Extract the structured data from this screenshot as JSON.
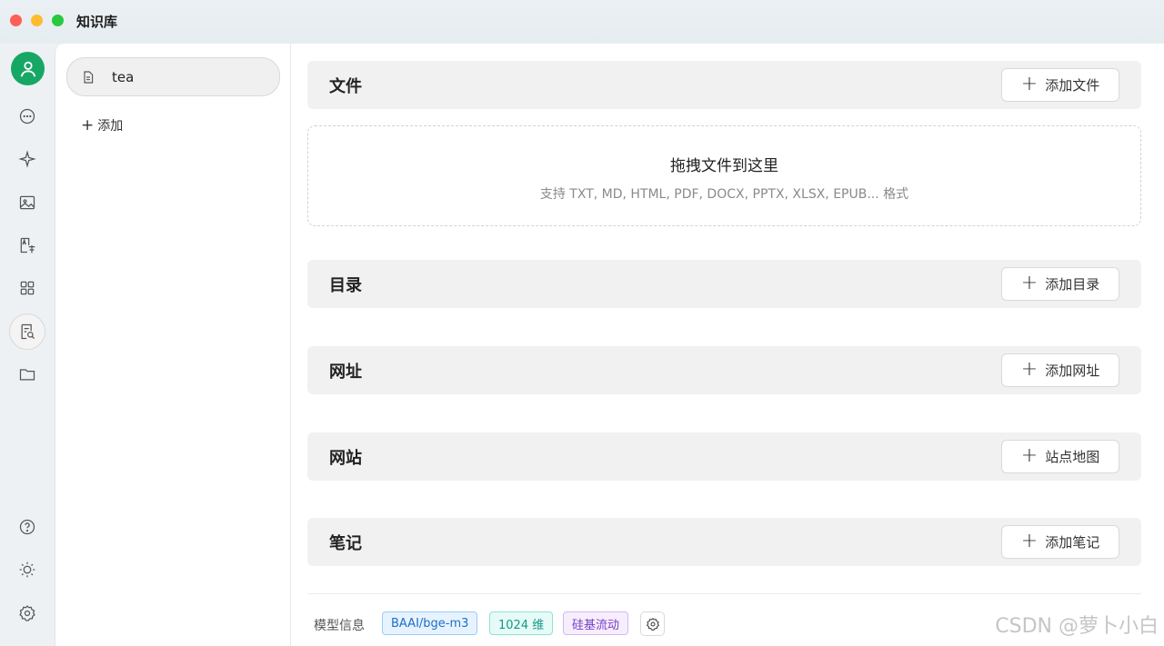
{
  "window": {
    "title": "知识库"
  },
  "rail": {
    "icons": [
      "avatar-icon",
      "chat-icon",
      "sparkle-icon",
      "image-icon",
      "translate-icon",
      "apps-icon",
      "knowledge-icon",
      "folder-icon",
      "help-icon",
      "theme-icon",
      "settings-icon"
    ]
  },
  "list": {
    "items": [
      {
        "label": "tea"
      }
    ],
    "add_label": "添加"
  },
  "sections": {
    "file": {
      "title": "文件",
      "button": "添加文件"
    },
    "directory": {
      "title": "目录",
      "button": "添加目录"
    },
    "url": {
      "title": "网址",
      "button": "添加网址"
    },
    "website": {
      "title": "网站",
      "button": "站点地图"
    },
    "note": {
      "title": "笔记",
      "button": "添加笔记"
    }
  },
  "dropzone": {
    "title": "拖拽文件到这里",
    "subtitle": "支持 TXT, MD, HTML, PDF, DOCX, PPTX, XLSX, EPUB... 格式"
  },
  "footer": {
    "label": "模型信息",
    "model": "BAAI/bge-m3",
    "dimensions": "1024 维",
    "provider": "硅基流动"
  },
  "watermark": "CSDN @萝卜小白",
  "colors": {
    "accent_green": "#16a765",
    "tag_blue": "#1f6fc4",
    "tag_cyan": "#14988a",
    "tag_purple": "#7a3ec2"
  }
}
